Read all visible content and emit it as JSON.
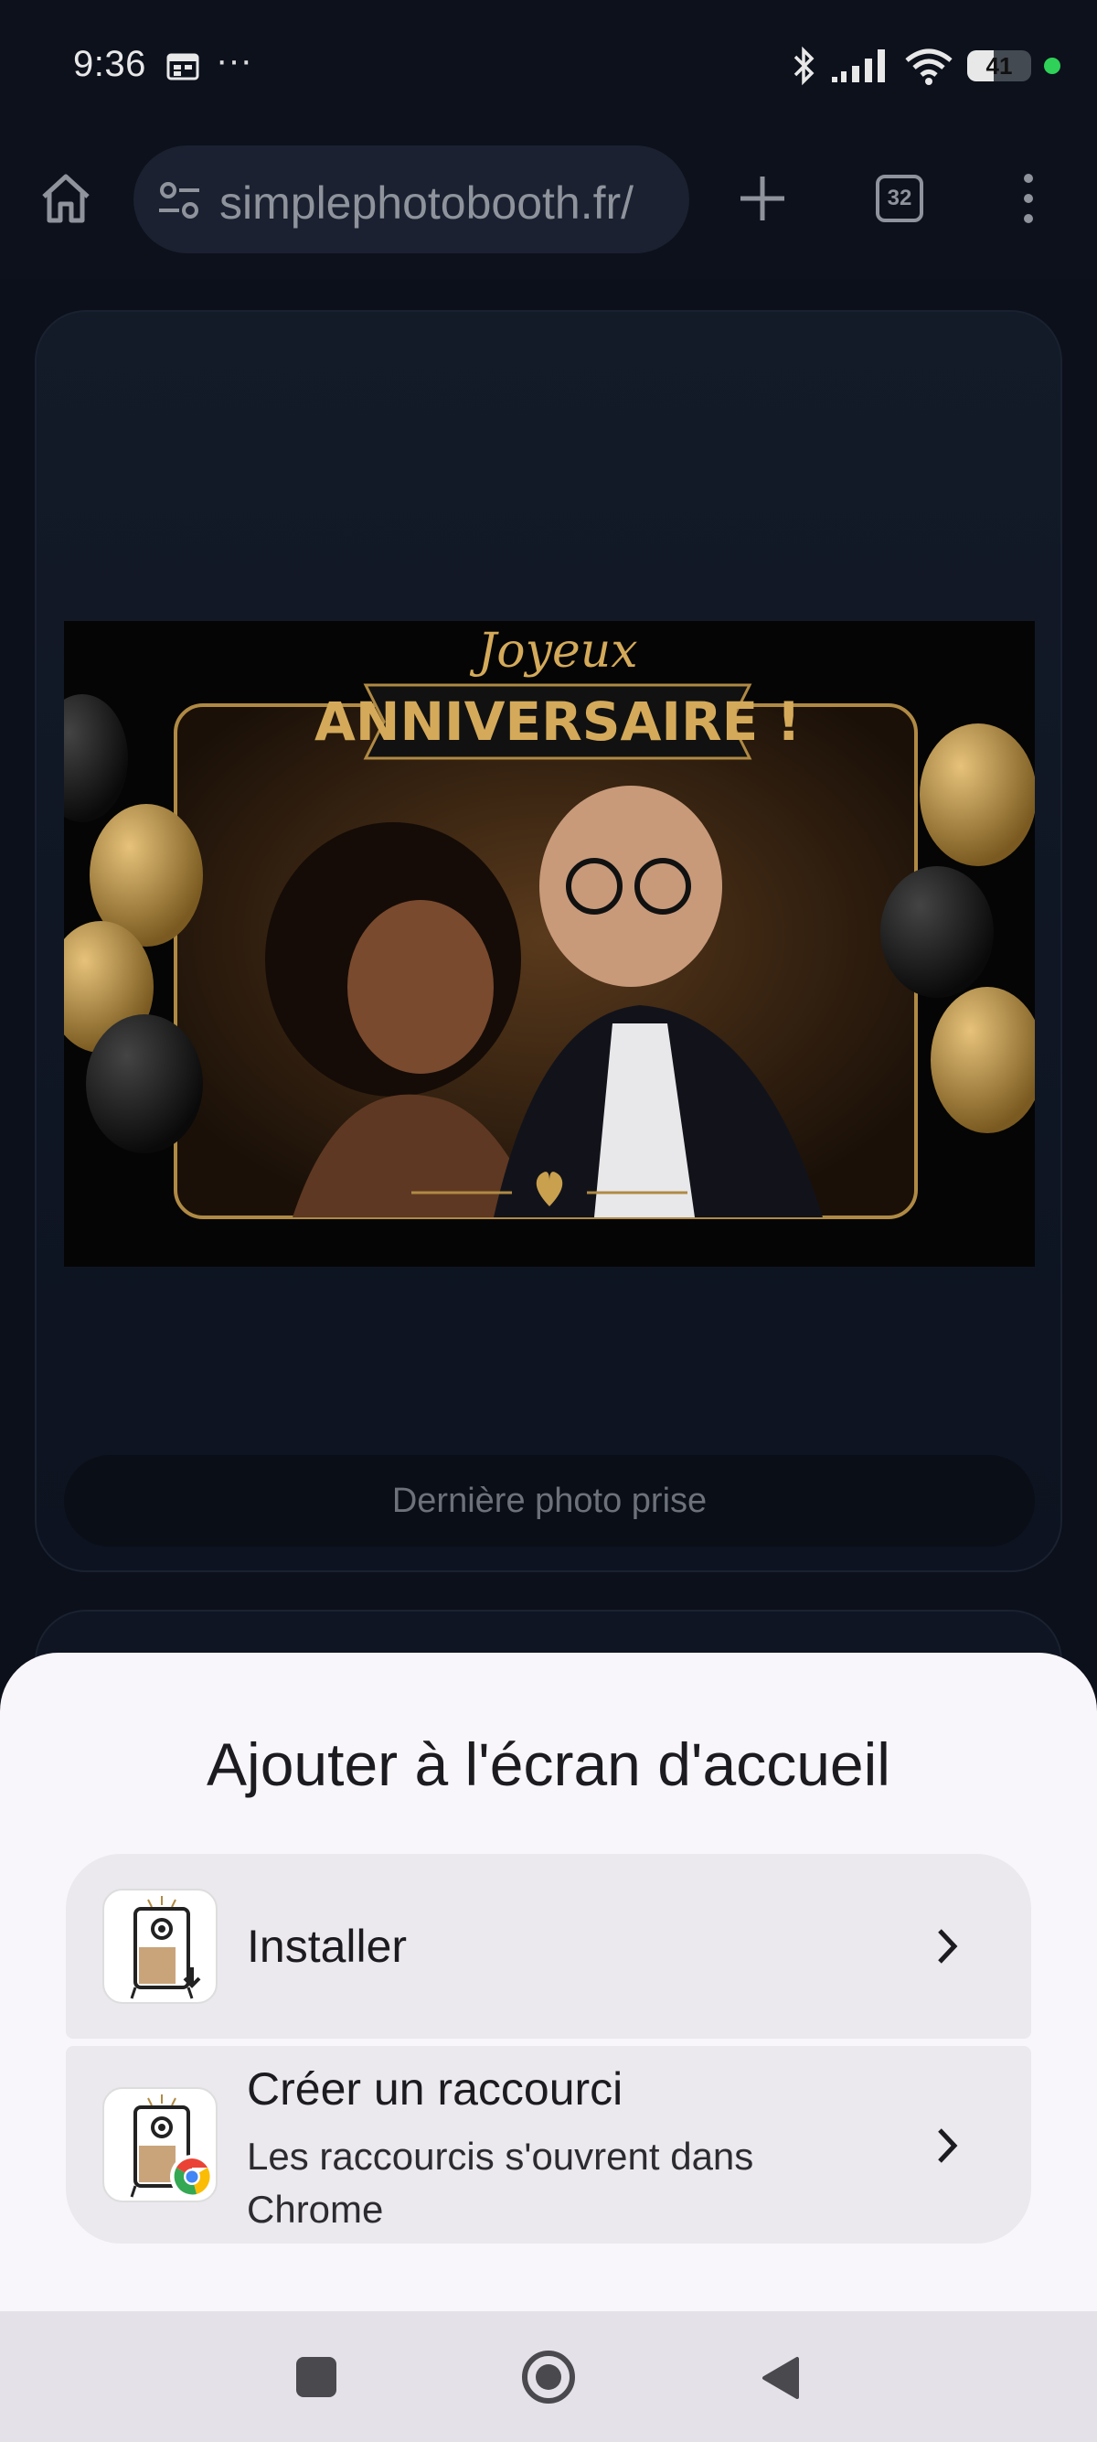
{
  "status_bar": {
    "time": "9:36",
    "overflow": "···",
    "battery": "41",
    "battery_level": 0.41,
    "icons": [
      "calendar-icon",
      "bluetooth-icon",
      "signal-icon",
      "wifi-icon",
      "battery-icon",
      "green-dot-indicator"
    ]
  },
  "toolbar": {
    "url": "simplephotobooth.fr/",
    "tab_count": "32",
    "icons": [
      "home-icon",
      "site-settings-icon",
      "plus-icon",
      "tabs-icon",
      "more-vert-icon"
    ]
  },
  "page": {
    "photo": {
      "banner_line1": "Joyeux",
      "banner_line2": "ANNIVERSAIRE !"
    },
    "last_photo_label": "Dernière photo prise"
  },
  "sheet": {
    "title": "Ajouter à l'écran d'accueil",
    "options": [
      {
        "label": "Installer",
        "icon": "app-install-icon"
      },
      {
        "label": "Créer un raccourci",
        "sublabel": "Les raccourcis s'ouvrent dans Chrome",
        "icon": "app-shortcut-chrome-icon"
      }
    ]
  },
  "nav": {
    "buttons": [
      "recents-button",
      "home-button",
      "back-button"
    ]
  },
  "colors": {
    "background": "#0b101b",
    "sheet": "#f8f6fb",
    "option": "#ebe8ee",
    "gold": "#c9a04e"
  }
}
